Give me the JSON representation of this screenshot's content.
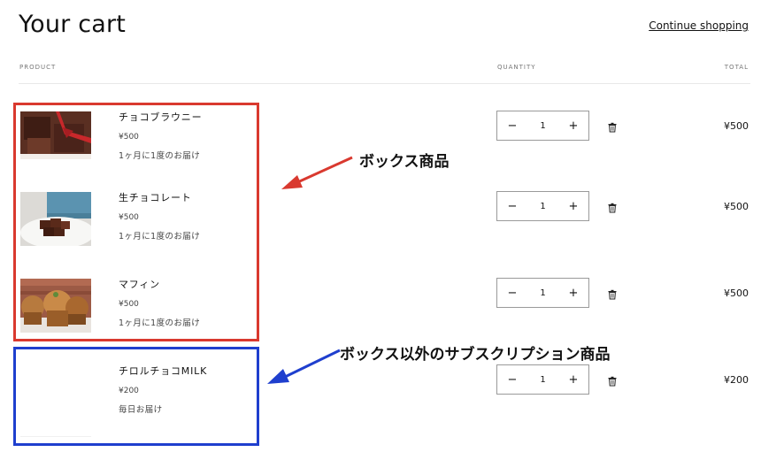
{
  "page": {
    "title": "Your cart",
    "continue_label": "Continue shopping",
    "headers": {
      "product": "PRODUCT",
      "quantity": "QUANTITY",
      "total": "TOTAL"
    }
  },
  "items": [
    {
      "name": "チョコブラウニー",
      "price": "¥500",
      "plan": "1ヶ月に1度のお届け",
      "qty": "1",
      "total": "¥500",
      "minus": "−",
      "plus": "+"
    },
    {
      "name": "生チョコレート",
      "price": "¥500",
      "plan": "1ヶ月に1度のお届け",
      "qty": "1",
      "total": "¥500",
      "minus": "−",
      "plus": "+"
    },
    {
      "name": "マフィン",
      "price": "¥500",
      "plan": "1ヶ月に1度のお届け",
      "qty": "1",
      "total": "¥500",
      "minus": "−",
      "plus": "+"
    },
    {
      "name": "チロルチョコMILK",
      "price": "¥200",
      "plan": "毎日お届け",
      "qty": "1",
      "total": "¥200",
      "minus": "−",
      "plus": "+"
    }
  ],
  "annotations": {
    "box_label": "ボックス商品",
    "other_label": "ボックス以外のサブスクリプション商品",
    "box_color": "#d9392f",
    "other_color": "#1f3fce"
  }
}
